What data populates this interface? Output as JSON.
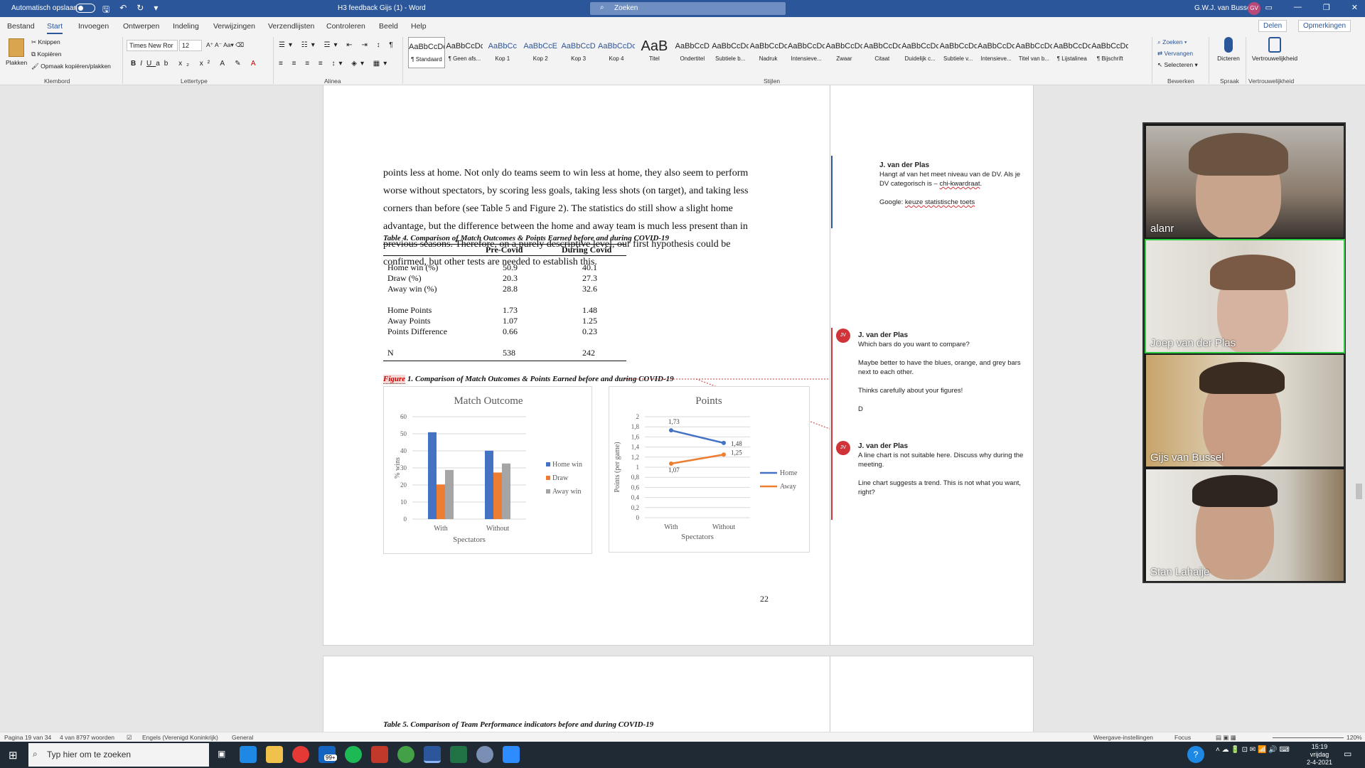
{
  "titlebar": {
    "autosave": "Automatisch opslaan",
    "doc_title": "H3 feedback Gijs (1)  -  Word",
    "search": "Zoeken",
    "user": "G.W.J. van Bussel",
    "user_initials": "GV"
  },
  "tabs": [
    "Bestand",
    "Start",
    "Invoegen",
    "Ontwerpen",
    "Indeling",
    "Verwijzingen",
    "Verzendlijsten",
    "Controleren",
    "Beeld",
    "Help"
  ],
  "share": "Delen",
  "comments_btn": "Opmerkingen",
  "ribbon": {
    "clipboard": {
      "paste": "Plakken",
      "cut": "Knippen",
      "copy": "Kopiëren",
      "format_painter": "Opmaak kopiëren/plakken",
      "label": "Klembord"
    },
    "font": {
      "name": "Times New Ror",
      "size": "12",
      "label": "Lettertype"
    },
    "paragraph": {
      "label": "Alinea"
    },
    "styles": {
      "label": "Stijlen",
      "items": [
        {
          "preview": "AaBbCcDc",
          "name": "¶ Standaard"
        },
        {
          "preview": "AaBbCcDc",
          "name": "¶ Geen afs..."
        },
        {
          "preview": "AaBbCc",
          "name": "Kop 1"
        },
        {
          "preview": "AaBbCcE",
          "name": "Kop 2"
        },
        {
          "preview": "AaBbCcD",
          "name": "Kop 3"
        },
        {
          "preview": "AaBbCcDc",
          "name": "Kop 4"
        },
        {
          "preview": "AaB",
          "name": "Titel"
        },
        {
          "preview": "AaBbCcD",
          "name": "Ondertitel"
        },
        {
          "preview": "AaBbCcDc",
          "name": "Subtiele b..."
        },
        {
          "preview": "AaBbCcDc",
          "name": "Nadruk"
        },
        {
          "preview": "AaBbCcDc",
          "name": "Intensieve..."
        },
        {
          "preview": "AaBbCcDc",
          "name": "Zwaar"
        },
        {
          "preview": "AaBbCcDc",
          "name": "Citaat"
        },
        {
          "preview": "AaBbCcDc",
          "name": "Duidelijk c..."
        },
        {
          "preview": "AaBbCcDc",
          "name": "Subtiele v..."
        },
        {
          "preview": "AaBbCcDc",
          "name": "Intensieve..."
        },
        {
          "preview": "AaBbCcDc",
          "name": "Titel van b..."
        },
        {
          "preview": "AaBbCcDc",
          "name": "¶ Lijstalinea"
        },
        {
          "preview": "AaBbCcDdE",
          "name": "¶ Bijschrift"
        }
      ]
    },
    "editing": {
      "find": "Zoeken",
      "replace": "Vervangen",
      "select": "Selecteren",
      "label": "Bewerken"
    },
    "speech": {
      "dictate": "Dicteren",
      "label": "Spraak"
    },
    "sensitivity": {
      "name": "Vertrouwelijkheid",
      "label": "Vertrouwelijkheid"
    }
  },
  "document": {
    "paragraph_lines": [
      "points less at home. Not only do teams seem to win less at home, they also seem to perform",
      "worse without spectators, by scoring less goals, taking less shots (on target), and taking less",
      "corners than before (see Table 5 and Figure 2). The statistics do still show a slight home",
      "advantage, but the difference between the home and away team is much less present than in",
      "previous seasons. Therefore, on a purely descriptive level, our first hypothesis could be",
      "confirmed, but other tests are needed to establish this."
    ],
    "table_caption": "Table 4. Comparison of Match Outcomes & Points Earned before and during COVID-19",
    "table": {
      "headers": [
        "Pre-Covid",
        "During Covid"
      ],
      "rows": [
        [
          "Home win (%)",
          "50.9",
          "40.1"
        ],
        [
          "Draw (%)",
          "20.3",
          "27.3"
        ],
        [
          "Away win (%)",
          "28.8",
          "32.6"
        ],
        [
          "Home Points",
          "1.73",
          "1.48"
        ],
        [
          "Away Points",
          "1.07",
          "1.25"
        ],
        [
          "Points Difference",
          "0.66",
          "0.23"
        ],
        [
          "N",
          "538",
          "242"
        ]
      ]
    },
    "figure_caption_word": "Figure",
    "figure_caption_rest": " 1. Comparison of Match Outcomes & Points Earned before and during COVID-19",
    "page_number": "22",
    "table5_caption": "Table 5. Comparison of Team Performance indicators before and during COVID-19"
  },
  "chart_data": [
    {
      "type": "bar",
      "title": "Match Outcome",
      "xlabel": "Spectators",
      "ylabel": "% wins",
      "categories": [
        "With",
        "Without"
      ],
      "ylim": [
        0,
        60
      ],
      "yticks": [
        "0",
        "10",
        "20",
        "30",
        "40",
        "50",
        "60"
      ],
      "series": [
        {
          "name": "Home win",
          "values": [
            50.9,
            40.1
          ],
          "color": "#4472c4"
        },
        {
          "name": "Draw",
          "values": [
            20.3,
            27.3
          ],
          "color": "#ed7d31"
        },
        {
          "name": "Away win",
          "values": [
            28.8,
            32.6
          ],
          "color": "#a5a5a5"
        }
      ],
      "legend": "right",
      "grid": true
    },
    {
      "type": "line",
      "title": "Points",
      "xlabel": "Spectators",
      "ylabel": "Points (per game)",
      "categories": [
        "With",
        "Without"
      ],
      "ylim": [
        0,
        2
      ],
      "yticks": [
        "0",
        "0,2",
        "0,4",
        "0,6",
        "0,8",
        "1",
        "1,2",
        "1,4",
        "1,6",
        "1,8",
        "2"
      ],
      "series": [
        {
          "name": "Home",
          "values": [
            1.73,
            1.48
          ],
          "labels": [
            "1,73",
            "1,48"
          ],
          "color": "#4472c4"
        },
        {
          "name": "Away",
          "values": [
            1.07,
            1.25
          ],
          "labels": [
            "1,07",
            "1,25"
          ],
          "color": "#ed7d31"
        }
      ],
      "legend": "right",
      "grid": true
    }
  ],
  "comment_panel": [
    {
      "author": "J. van der Plas",
      "lines": [
        "Hangt af van het meet niveau van de DV. Als je DV categorisch is – "
      ],
      "link": "chi-kwardraat",
      "after_link": ".",
      "google_prefix": "Google: ",
      "google_link": "keuze statistische toets"
    },
    {
      "author": "J. van der Plas",
      "initials": "JV",
      "lines": [
        "Which bars do you want to compare?",
        "",
        "Maybe better to have the blues, orange, and grey bars next to each other.",
        "",
        "Thinks carefully about your figures!",
        "",
        "D"
      ]
    },
    {
      "author": "J. van der Plas",
      "initials": "JV",
      "lines": [
        "A line chart is not suitable here. Discuss why during the meeting.",
        "",
        "Line chart suggests a trend. This is not what you want, right?"
      ]
    }
  ],
  "zoom_participants": [
    "alanr",
    "Joep van der Plas",
    "Gijs van Bussel",
    "Stan Lahaije"
  ],
  "statusbar": {
    "page": "Pagina 19 van 34",
    "words": "4 van 8797 woorden",
    "language": "Engels (Verenigd Koninkrijk)",
    "general": "General",
    "display_settings": "Weergave-instellingen",
    "focus": "Focus",
    "zoom": "120%"
  },
  "taskbar": {
    "search": "Typ hier om te zoeken",
    "badge": "99+",
    "time": "15:19",
    "day": "vrijdag",
    "date": "2-4-2021"
  }
}
